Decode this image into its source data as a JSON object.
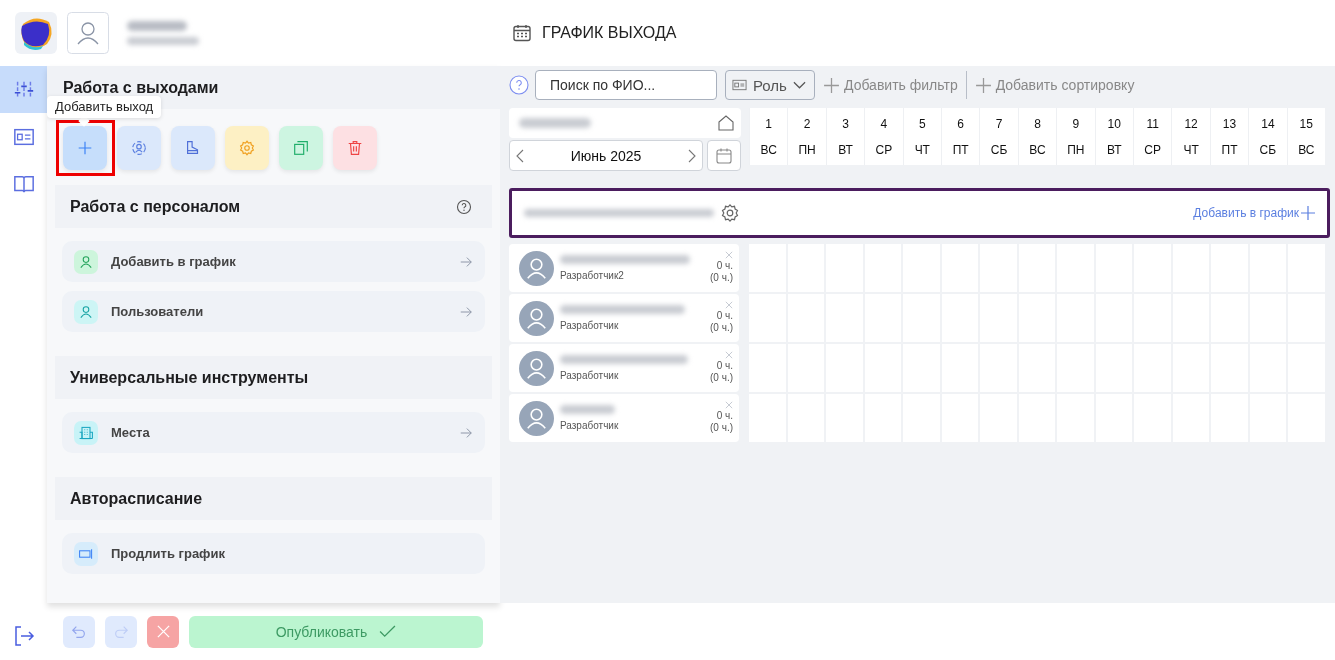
{
  "header": {
    "title": "ГРАФИК ВЫХОДА"
  },
  "rail": [
    {
      "kind": "sliders",
      "selected": true
    },
    {
      "kind": "card",
      "selected": false
    },
    {
      "kind": "book",
      "selected": false
    }
  ],
  "panel": {
    "sections": [
      {
        "title": "Работа с выходами",
        "help": false,
        "actions": [
          {
            "kind": "add",
            "highlighted": true,
            "tooltip": "Добавить выход"
          },
          {
            "kind": "person",
            "highlighted": false
          },
          {
            "kind": "boot",
            "highlighted": false
          },
          {
            "kind": "gear",
            "highlighted": false
          },
          {
            "kind": "copy",
            "highlighted": false
          },
          {
            "kind": "trash",
            "highlighted": false
          }
        ]
      },
      {
        "title": "Работа с персоналом",
        "help": true,
        "items": [
          {
            "label": "Добавить в график",
            "kind": "person-add",
            "arrow": true
          },
          {
            "label": "Пользователи",
            "kind": "users",
            "arrow": true
          }
        ]
      },
      {
        "title": "Универсальные инструменты",
        "help": false,
        "items": [
          {
            "label": "Места",
            "kind": "building",
            "arrow": true
          }
        ]
      },
      {
        "title": "Авторасписание",
        "help": false,
        "items": [
          {
            "label": "Продлить график",
            "kind": "extend",
            "arrow": false
          }
        ]
      }
    ]
  },
  "toolbar": {
    "search_placeholder": "Поиск по ФИО...",
    "role_filter": "Роль",
    "add_filter": "Добавить фильтр",
    "add_sort": "Добавить сортировку"
  },
  "calendar": {
    "month": "Июнь 2025",
    "days": [
      {
        "num": "1",
        "weekday": "ВС"
      },
      {
        "num": "2",
        "weekday": "ПН"
      },
      {
        "num": "3",
        "weekday": "ВТ"
      },
      {
        "num": "4",
        "weekday": "СР"
      },
      {
        "num": "5",
        "weekday": "ЧТ"
      },
      {
        "num": "6",
        "weekday": "ПТ"
      },
      {
        "num": "7",
        "weekday": "СБ"
      },
      {
        "num": "8",
        "weekday": "ВС"
      },
      {
        "num": "9",
        "weekday": "ПН"
      },
      {
        "num": "10",
        "weekday": "ВТ"
      },
      {
        "num": "11",
        "weekday": "СР"
      },
      {
        "num": "12",
        "weekday": "ЧТ"
      },
      {
        "num": "13",
        "weekday": "ПТ"
      },
      {
        "num": "14",
        "weekday": "СБ"
      },
      {
        "num": "15",
        "weekday": "ВС"
      }
    ]
  },
  "group": {
    "add_label": "Добавить в график"
  },
  "employees": [
    {
      "role": "Разработчик2",
      "hours": "0 ч.",
      "planned": "(0 ч.)"
    },
    {
      "role": "Разработчик",
      "hours": "0 ч.",
      "planned": "(0 ч.)"
    },
    {
      "role": "Разработчик",
      "hours": "0 ч.",
      "planned": "(0 ч.)"
    },
    {
      "role": "Разработчик",
      "hours": "0 ч.",
      "planned": "(0 ч.)"
    }
  ],
  "footer": {
    "undo": {
      "disabled": true
    },
    "redo": {
      "disabled": true
    },
    "cancel": {
      "disabled": true
    },
    "publish": {
      "label": "Опубликовать",
      "disabled": true
    }
  }
}
